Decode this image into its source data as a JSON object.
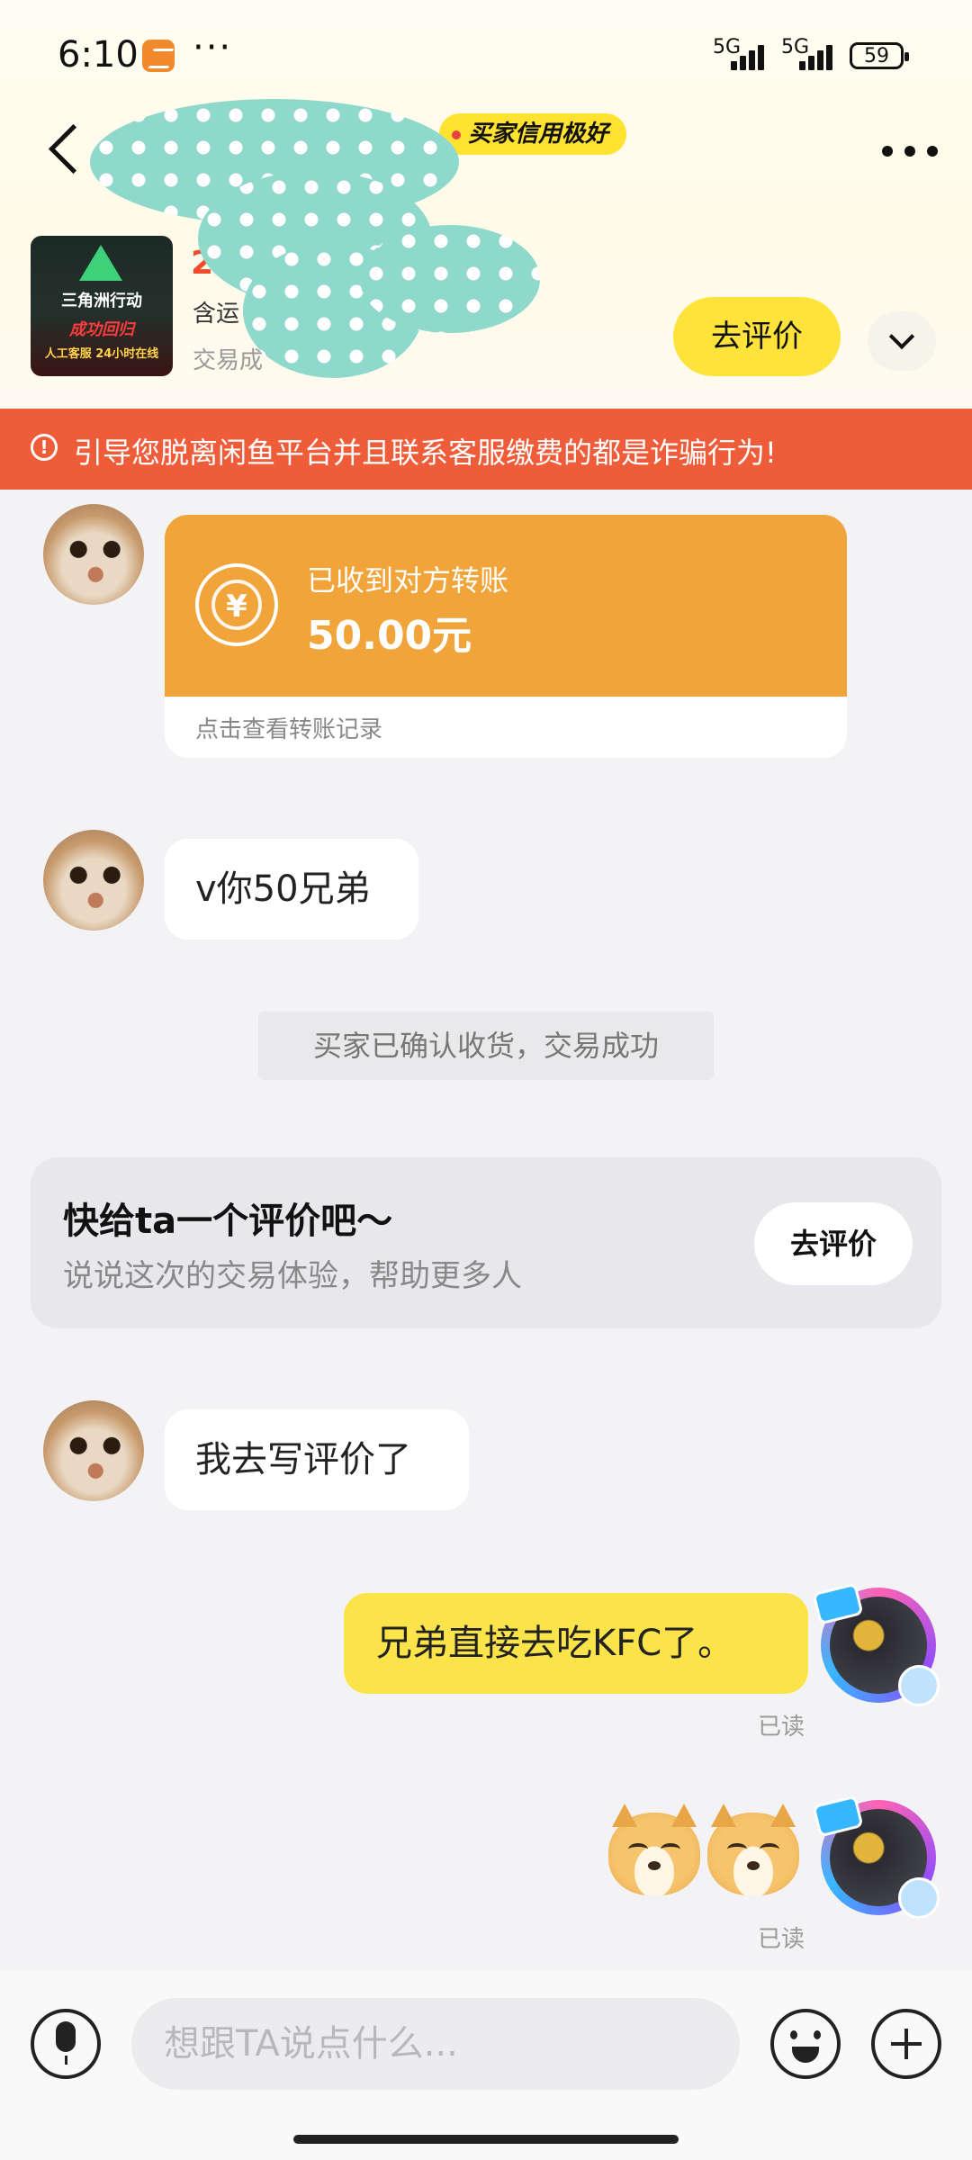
{
  "status_bar": {
    "time": "6:10",
    "signal_1": "5G",
    "signal_2": "5G",
    "battery": "59"
  },
  "header": {
    "credit_badge": "买家信用极好",
    "product": {
      "image_title": "三角洲行动",
      "image_line2": "成功回归",
      "image_line3": "人工客服 24小时在线",
      "price_partial": "2",
      "shipping_partial": "含运",
      "deal_status_partial": "交易成"
    },
    "review_button": "去评价"
  },
  "warning_banner": {
    "icon": "!",
    "text": "引导您脱离闲鱼平台并且联系客服缴费的都是诈骗行为!"
  },
  "messages": {
    "transfer": {
      "icon": "¥",
      "label": "已收到对方转账",
      "amount": "50.00元",
      "link": "点击查看转账记录"
    },
    "text_1": "v你50兄弟",
    "system": "买家已确认收货，交易成功",
    "review_card": {
      "title": "快给ta一个评价吧～",
      "subtitle": "说说这次的交易体验，帮助更多人",
      "button": "去评价"
    },
    "text_2": "我去写评价了",
    "my_text": "兄弟直接去吃KFC了。",
    "read_1": "已读",
    "read_2": "已读"
  },
  "input_bar": {
    "placeholder": "想跟TA说点什么..."
  },
  "colors": {
    "accent_yellow": "#fbe34a",
    "warning_red": "#ef5c3a",
    "transfer_orange": "#f0a43a"
  }
}
